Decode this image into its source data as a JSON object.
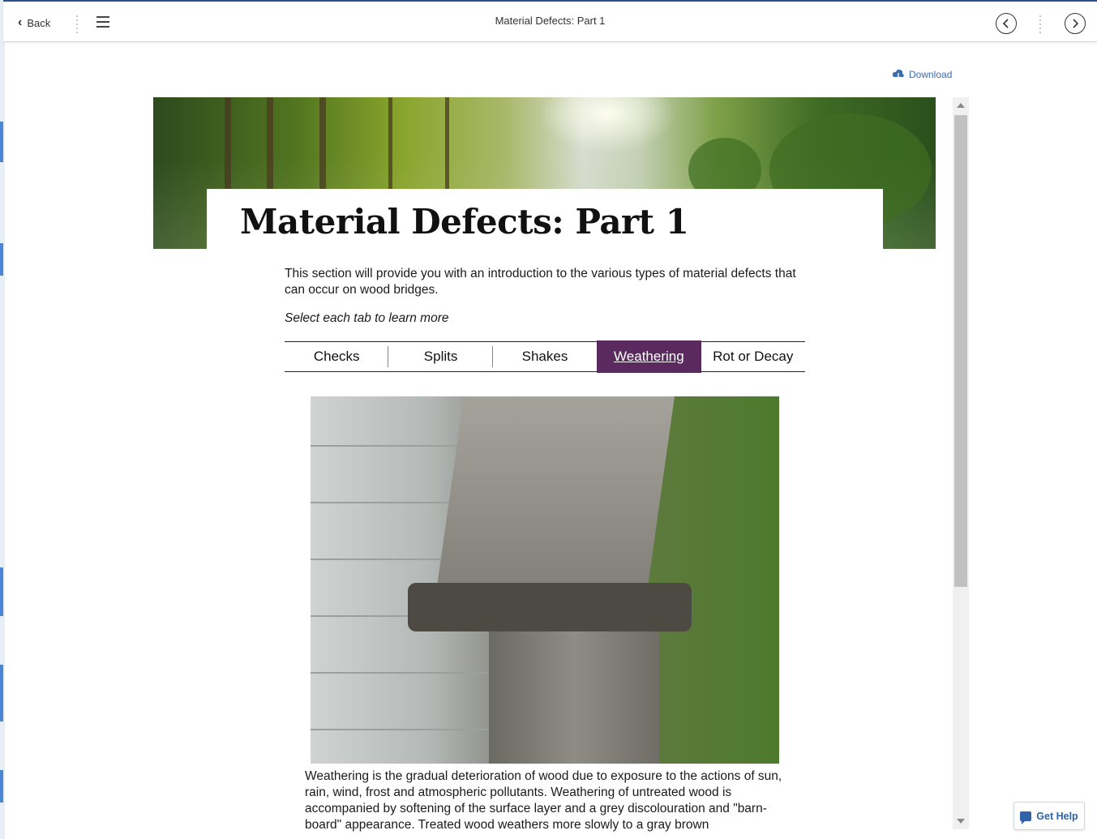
{
  "topbar": {
    "back_label": "Back",
    "title": "Material Defects: Part 1",
    "prev_icon": "chevron-left-circle-icon",
    "next_icon": "chevron-right-circle-icon"
  },
  "toolbar": {
    "download_label": "Download"
  },
  "lesson": {
    "title": "Material Defects: Part 1",
    "intro": "This section will provide you with an introduction to the various types of material defects that can occur on wood bridges.",
    "instruction": "Select each tab to learn more",
    "tabs": [
      {
        "label": "Checks",
        "active": false
      },
      {
        "label": "Splits",
        "active": false
      },
      {
        "label": "Shakes",
        "active": false
      },
      {
        "label": "Weathering",
        "active": true
      },
      {
        "label": "Rot or Decay",
        "active": false
      }
    ],
    "description": "Weathering is the gradual deterioration of wood due to exposure to the actions of sun, rain, wind, frost and atmospheric pollutants. Weathering of untreated wood is accompanied by softening of the surface layer and a grey discolouration and \"barn-board\" appearance. Treated wood weathers more slowly to a gray brown"
  },
  "help": {
    "label": "Get Help"
  },
  "colors": {
    "active_tab": "#5a2a5e",
    "link_blue": "#3a6cb0",
    "help_blue": "#2f62a8"
  }
}
